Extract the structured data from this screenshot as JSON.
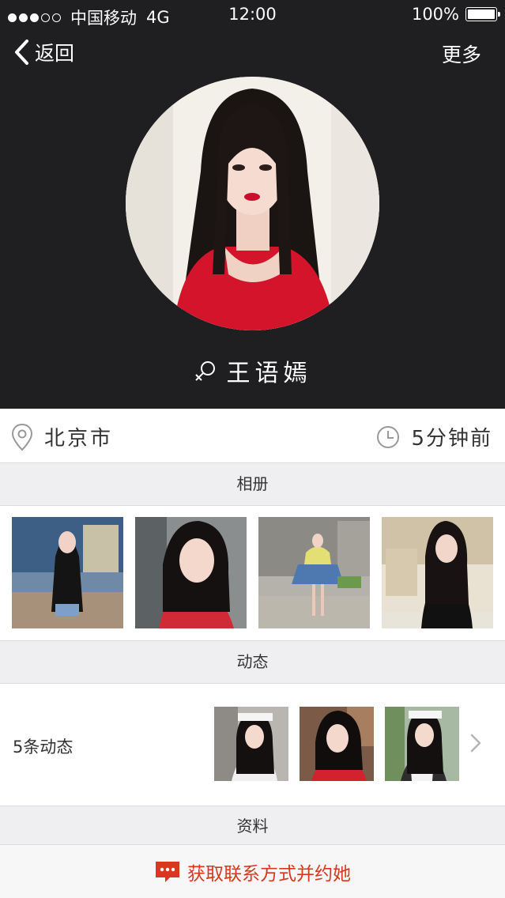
{
  "status_bar": {
    "carrier": "中国移动",
    "network": "4G",
    "time": "12:00",
    "battery": "100%"
  },
  "nav": {
    "back_label": "返回",
    "more_label": "更多"
  },
  "profile": {
    "name": "王语嫣",
    "location": "北京市",
    "last_active": "5分钟前"
  },
  "sections": {
    "album": "相册",
    "feed": "动态",
    "info": "资料"
  },
  "feed": {
    "count_label": "5条动态"
  },
  "bottom_bar": {
    "contact_label": "获取联系方式并约她"
  },
  "colors": {
    "header_bg": "#1f1e20",
    "accent": "#d9371e",
    "section_bg": "#efeff1"
  },
  "icons": [
    "chevron-left-icon",
    "female-gender-icon",
    "location-pin-icon",
    "clock-icon",
    "chevron-right-icon",
    "chat-bubble-icon"
  ]
}
